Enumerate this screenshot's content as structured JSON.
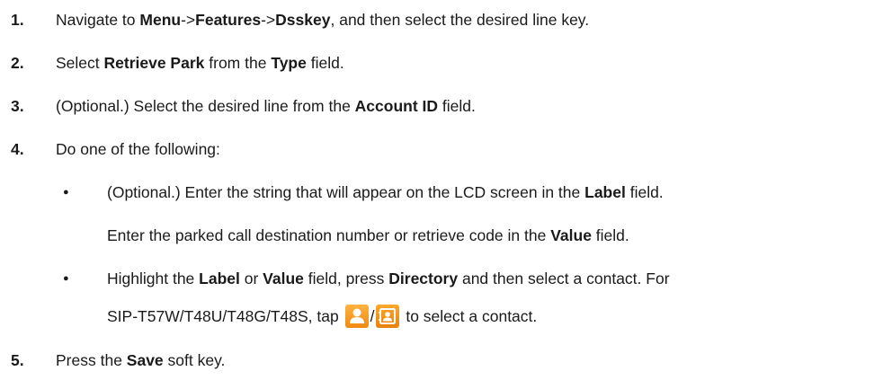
{
  "steps": [
    {
      "num": "1.",
      "parts": [
        "Navigate to ",
        "Menu",
        "->",
        "Features",
        "->",
        "Dsskey",
        ", and then select the desired line key."
      ]
    },
    {
      "num": "2.",
      "parts": [
        "Select ",
        "Retrieve Park",
        " from the ",
        "Type",
        " field."
      ]
    },
    {
      "num": "3.",
      "parts": [
        "(Optional.) Select the desired line from the ",
        "Account ID",
        " field."
      ]
    },
    {
      "num": "4.",
      "parts": [
        "Do one of the following:"
      ]
    },
    {
      "num": "5.",
      "parts": [
        "Press the ",
        "Save",
        " soft key."
      ]
    }
  ],
  "bullets": [
    {
      "line1": [
        "(Optional.) Enter the string that will appear on the LCD screen in the ",
        "Label",
        " field."
      ],
      "line2": [
        "Enter the parked call destination number or retrieve code in the ",
        "Value",
        " field."
      ]
    },
    {
      "line1": [
        "Highlight the ",
        "Label",
        " or ",
        "Value",
        " field, press ",
        "Directory",
        " and then select a contact. For"
      ],
      "line2": [
        "SIP-T57W/T48U/T48G/T48S, tap ",
        "/",
        " to select a contact."
      ]
    }
  ],
  "bullet_glyph": "●",
  "icons": {
    "contact_icon": "contact-person-icon",
    "directory_icon": "directory-book-icon",
    "color": "#f59a1e"
  }
}
